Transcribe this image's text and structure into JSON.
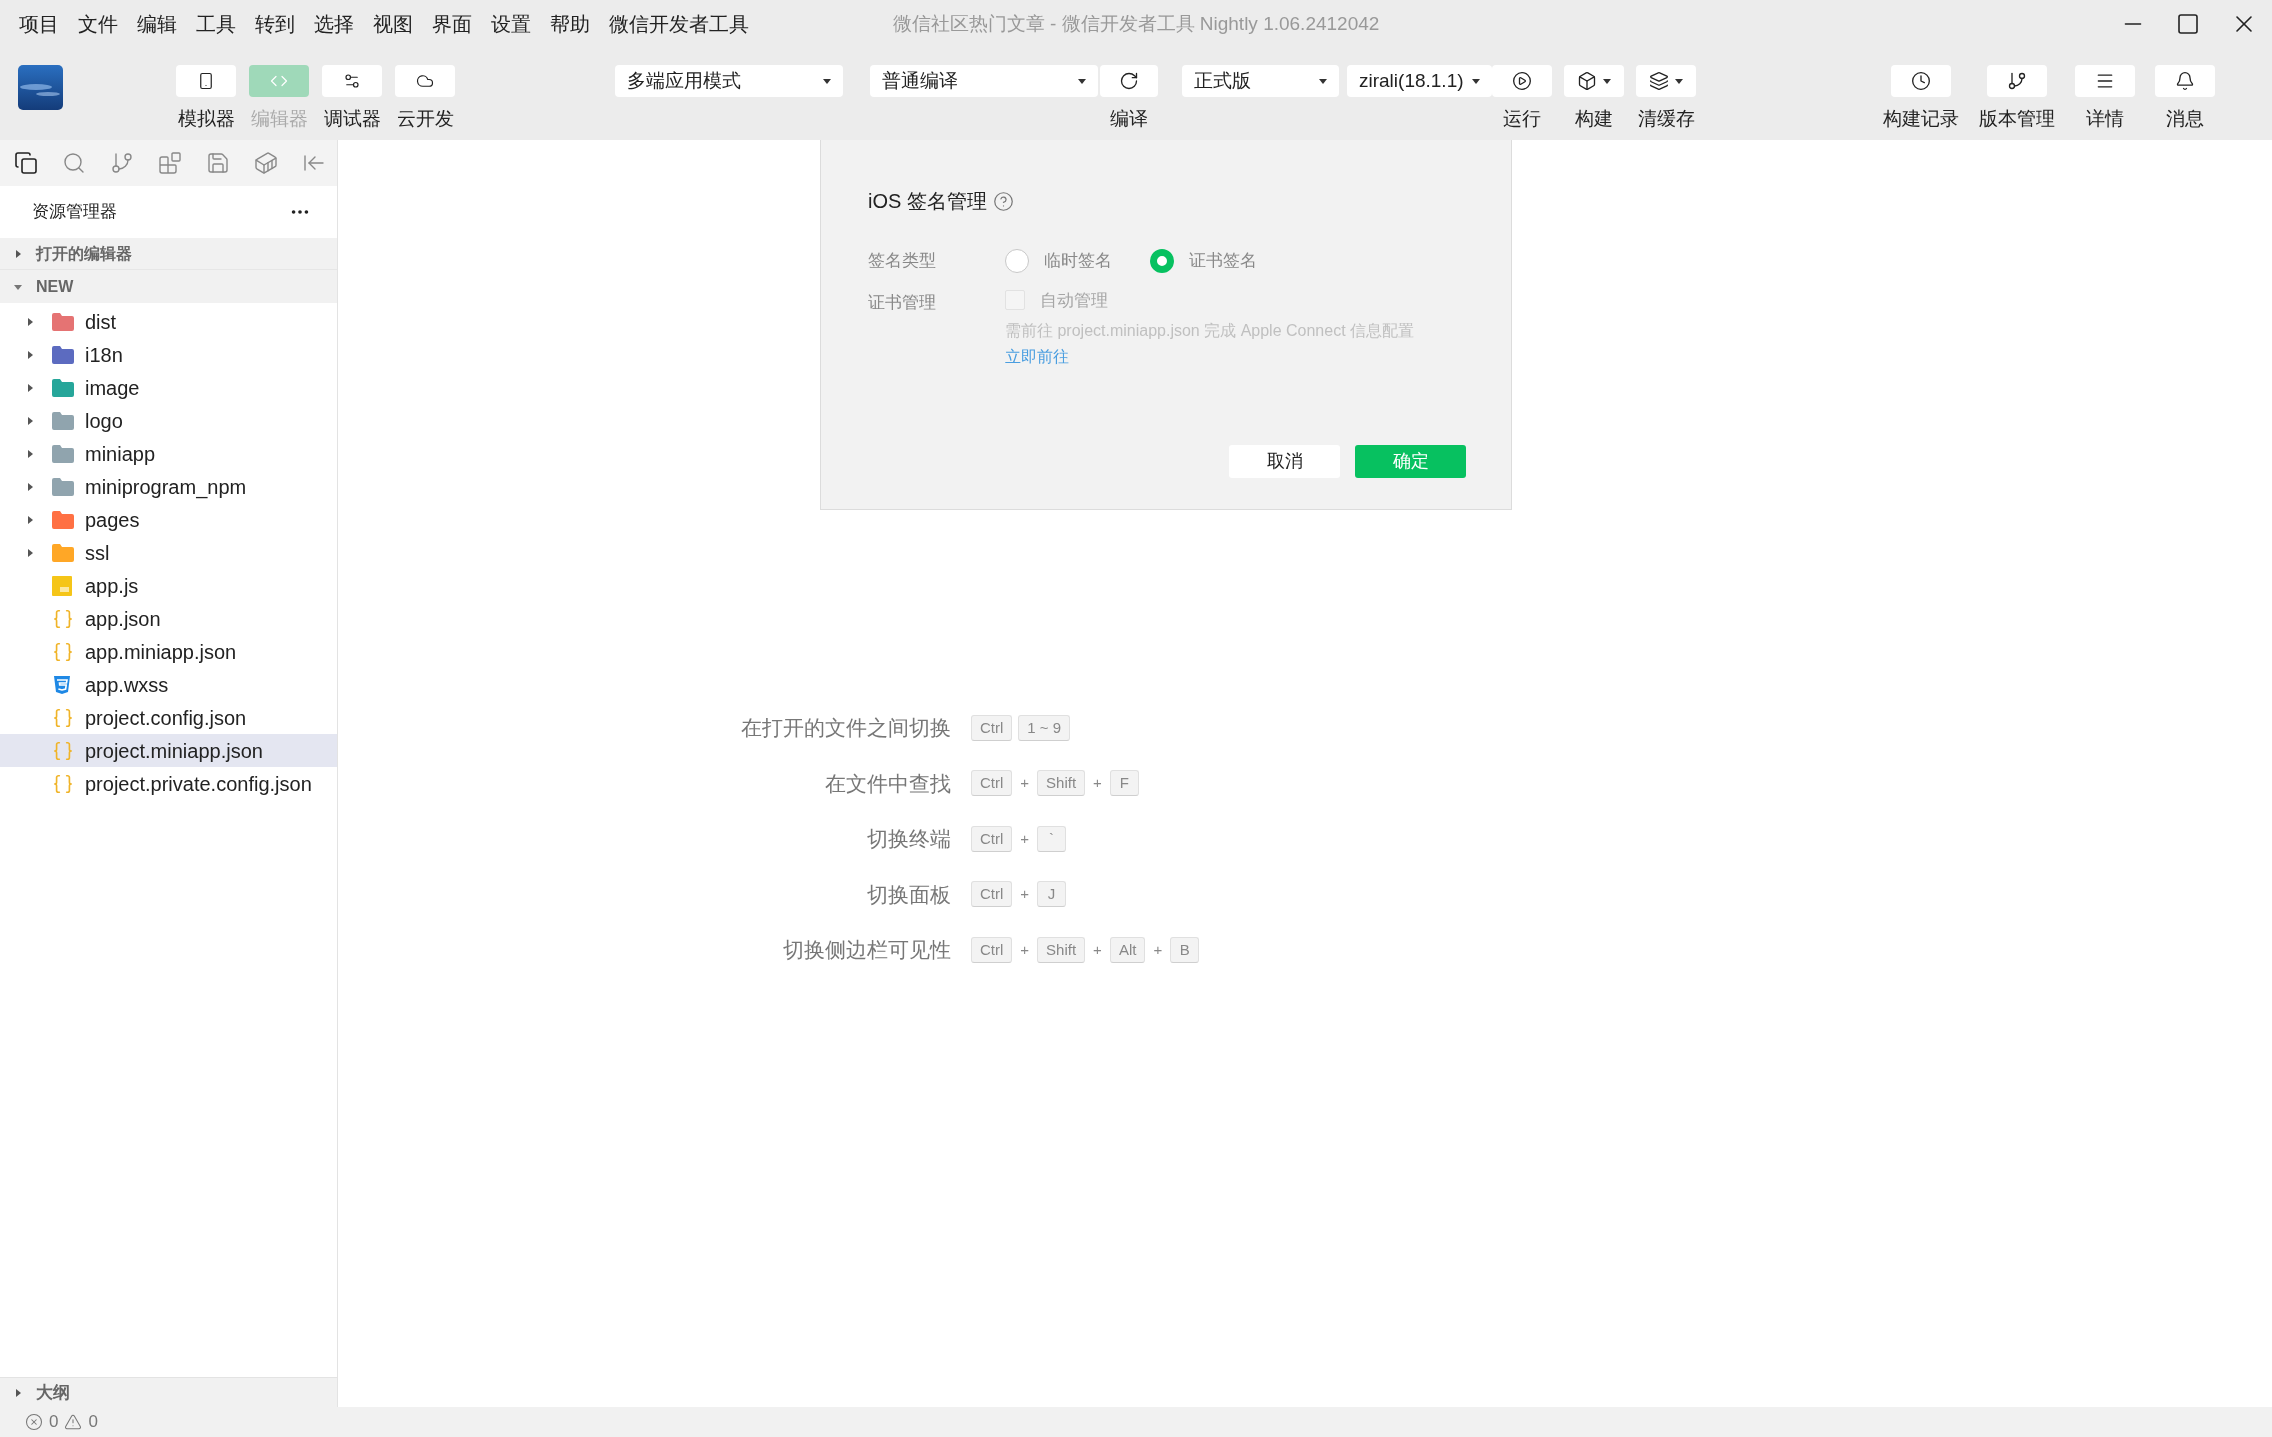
{
  "menu": [
    "项目",
    "文件",
    "编辑",
    "工具",
    "转到",
    "选择",
    "视图",
    "界面",
    "设置",
    "帮助",
    "微信开发者工具"
  ],
  "window": {
    "title": "微信社区热门文章 - 微信开发者工具 Nightly 1.06.2412042"
  },
  "toolbar": {
    "view_buttons": [
      {
        "label": "模拟器",
        "selected": false
      },
      {
        "label": "编辑器",
        "selected": true
      },
      {
        "label": "调试器",
        "selected": false
      },
      {
        "label": "云开发",
        "selected": false
      }
    ],
    "mode_select": "多端应用模式",
    "compile_select": "普通编译",
    "compile_label": "编译",
    "version_select": "正式版",
    "device_select": "zirali(18.1.1)",
    "actions": [
      {
        "label": "运行",
        "kind": "play"
      },
      {
        "label": "构建",
        "kind": "menu"
      },
      {
        "label": "清缓存",
        "kind": "menu"
      }
    ],
    "right_buttons": [
      "构建记录",
      "版本管理",
      "详情",
      "消息"
    ]
  },
  "sidebar": {
    "title": "资源管理器",
    "open_editors": {
      "label": "打开的编辑器",
      "expanded": false
    },
    "project": {
      "label": "NEW",
      "expanded": true,
      "children": [
        {
          "name": "dist",
          "kind": "folder",
          "color": "#e57373",
          "expanded": false,
          "selected": false
        },
        {
          "name": "i18n",
          "kind": "folder",
          "color": "#5c6bc0",
          "expanded": false,
          "selected": false
        },
        {
          "name": "image",
          "kind": "folder",
          "color": "#26a69a",
          "expanded": false,
          "selected": false
        },
        {
          "name": "logo",
          "kind": "folder",
          "color": "#90a4ae",
          "expanded": false,
          "selected": false
        },
        {
          "name": "miniapp",
          "kind": "folder",
          "color": "#90a4ae",
          "expanded": false,
          "selected": false
        },
        {
          "name": "miniprogram_npm",
          "kind": "folder",
          "color": "#90a4ae",
          "expanded": false,
          "selected": false
        },
        {
          "name": "pages",
          "kind": "folder",
          "color": "#ff7043",
          "expanded": false,
          "selected": false
        },
        {
          "name": "ssl",
          "kind": "folder",
          "color": "#ffa726",
          "expanded": false,
          "selected": false
        },
        {
          "name": "app.js",
          "kind": "js",
          "selected": false
        },
        {
          "name": "app.json",
          "kind": "json",
          "selected": false
        },
        {
          "name": "app.miniapp.json",
          "kind": "json",
          "selected": false
        },
        {
          "name": "app.wxss",
          "kind": "css",
          "selected": false
        },
        {
          "name": "project.config.json",
          "kind": "json",
          "selected": false
        },
        {
          "name": "project.miniapp.json",
          "kind": "json",
          "selected": true
        },
        {
          "name": "project.private.config.json",
          "kind": "json",
          "selected": false
        }
      ]
    },
    "outline": {
      "label": "大纲",
      "expanded": false
    }
  },
  "status_bar": {
    "errors": "0",
    "warnings": "0"
  },
  "dialog": {
    "title": "iOS 签名管理",
    "fields": [
      {
        "label": "签名类型",
        "kind": "radio",
        "options": [
          {
            "label": "临时签名",
            "selected": false
          },
          {
            "label": "证书签名",
            "selected": true
          }
        ]
      },
      {
        "label": "证书管理",
        "kind": "checkbox",
        "option": {
          "label": "自动管理",
          "checked": false,
          "disabled": true
        },
        "hint": "需前往 project.miniapp.json 完成 Apple Connect 信息配置",
        "link": "立即前往"
      }
    ],
    "buttons": [
      {
        "label": "取消",
        "kind": "secondary"
      },
      {
        "label": "确定",
        "kind": "primary"
      }
    ]
  },
  "shortcuts": [
    {
      "label": "在打开的文件之间切换",
      "keys": [
        {
          "kind": "key",
          "text": "Ctrl"
        },
        {
          "kind": "key",
          "text": "1 ~ 9"
        }
      ]
    },
    {
      "label": "在文件中查找",
      "keys": [
        {
          "kind": "key",
          "text": "Ctrl"
        },
        {
          "kind": "plus",
          "text": "+"
        },
        {
          "kind": "key",
          "text": "Shift"
        },
        {
          "kind": "plus",
          "text": "+"
        },
        {
          "kind": "key",
          "text": "F"
        }
      ]
    },
    {
      "label": "切换终端",
      "keys": [
        {
          "kind": "key",
          "text": "Ctrl"
        },
        {
          "kind": "plus",
          "text": "+"
        },
        {
          "kind": "key",
          "text": "`"
        }
      ]
    },
    {
      "label": "切换面板",
      "keys": [
        {
          "kind": "key",
          "text": "Ctrl"
        },
        {
          "kind": "plus",
          "text": "+"
        },
        {
          "kind": "key",
          "text": "J"
        }
      ]
    },
    {
      "label": "切换侧边栏可见性",
      "keys": [
        {
          "kind": "key",
          "text": "Ctrl"
        },
        {
          "kind": "plus",
          "text": "+"
        },
        {
          "kind": "key",
          "text": "Shift"
        },
        {
          "kind": "plus",
          "text": "+"
        },
        {
          "kind": "key",
          "text": "Alt"
        },
        {
          "kind": "plus",
          "text": "+"
        },
        {
          "kind": "key",
          "text": "B"
        }
      ]
    }
  ]
}
